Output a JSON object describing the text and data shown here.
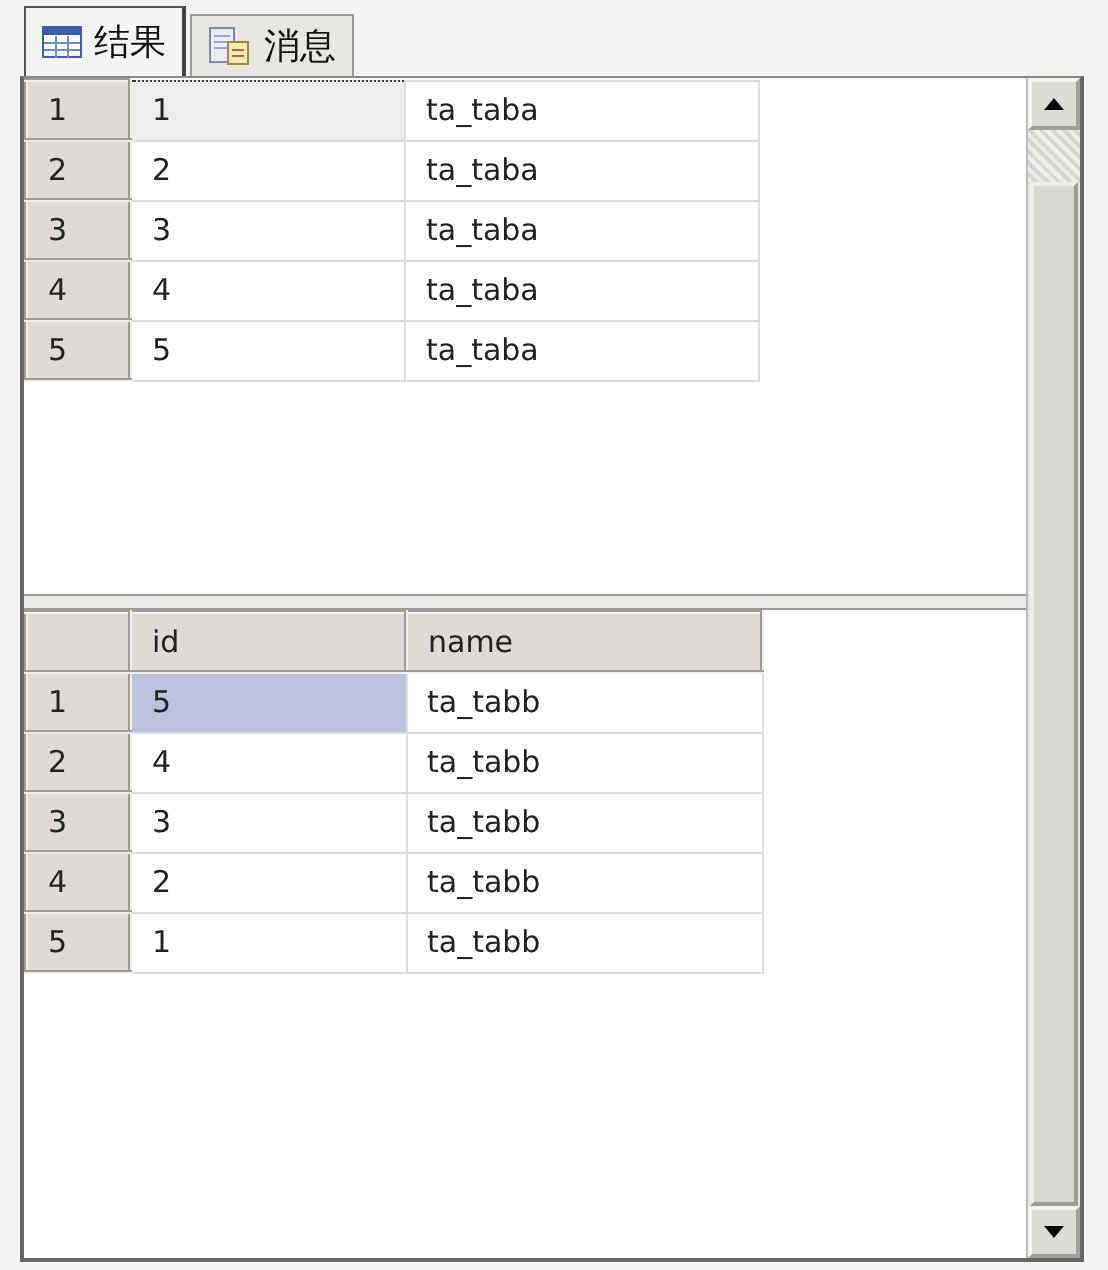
{
  "tabs": [
    {
      "label": "结果",
      "kind": "table",
      "selected": true
    },
    {
      "label": "消息",
      "kind": "document",
      "selected": false
    }
  ],
  "grids": [
    {
      "focused": false,
      "rows": [
        {
          "number": "1",
          "cells": [
            "1",
            "ta_taba"
          ],
          "selected": true
        },
        {
          "number": "2",
          "cells": [
            "2",
            "ta_taba"
          ],
          "selected": false
        },
        {
          "number": "3",
          "cells": [
            "3",
            "ta_taba"
          ],
          "selected": false
        },
        {
          "number": "4",
          "cells": [
            "4",
            "ta_taba"
          ],
          "selected": false
        },
        {
          "number": "5",
          "cells": [
            "5",
            "ta_taba"
          ],
          "selected": false
        }
      ]
    },
    {
      "focused": true,
      "columns": [
        "id",
        "name"
      ],
      "rows": [
        {
          "number": "1",
          "cells": [
            "5",
            "ta_tabb"
          ],
          "selected": true
        },
        {
          "number": "2",
          "cells": [
            "4",
            "ta_tabb"
          ],
          "selected": false
        },
        {
          "number": "3",
          "cells": [
            "3",
            "ta_tabb"
          ],
          "selected": false
        },
        {
          "number": "4",
          "cells": [
            "2",
            "ta_tabb"
          ],
          "selected": false
        },
        {
          "number": "5",
          "cells": [
            "1",
            "ta_tabb"
          ],
          "selected": false
        }
      ]
    }
  ]
}
